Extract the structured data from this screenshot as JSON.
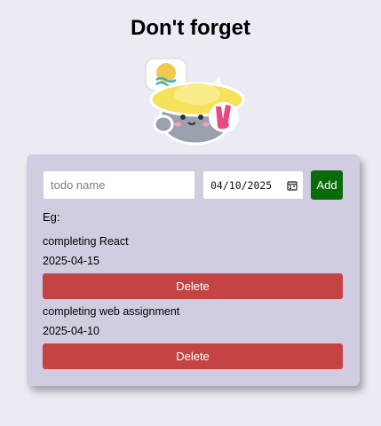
{
  "header": {
    "title": "Don't forget"
  },
  "form": {
    "name_placeholder": "todo name",
    "name_value": "",
    "date_value": "04/10/2025",
    "add_label": "Add"
  },
  "list": {
    "example_label": "Eg:",
    "delete_label": "Delete",
    "items": [
      {
        "name": "completing React",
        "date": "2025-04-15"
      },
      {
        "name": "completing web assignment",
        "date": "2025-04-10"
      }
    ]
  },
  "colors": {
    "background": "#ecebf3",
    "card": "#d2cce0",
    "add_button": "#0a6b0a",
    "delete_button": "#c44444"
  },
  "icons": {
    "sticker": "cat-with-sun-hat-sticker-icon",
    "calendar": "calendar-icon"
  }
}
